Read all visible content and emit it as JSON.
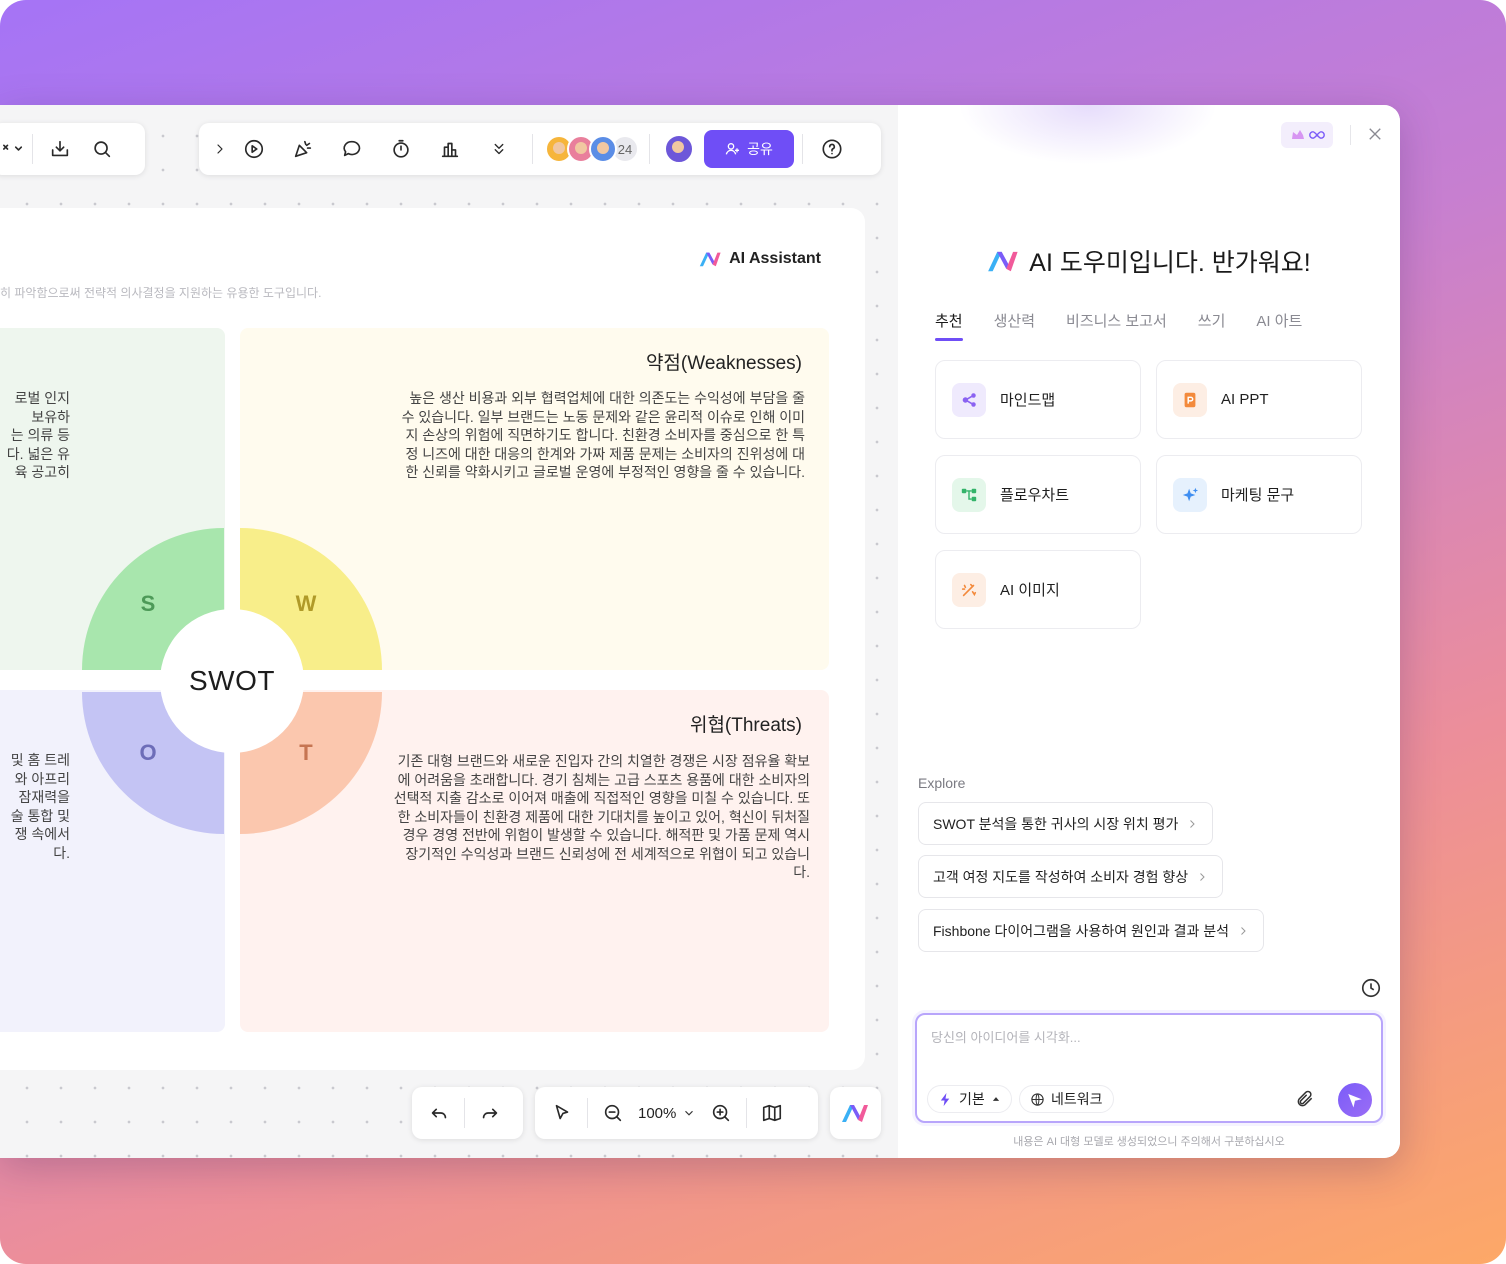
{
  "toolbar_top": {
    "left_items": [
      "export-icon",
      "search-icon"
    ],
    "collaborator_count": "24",
    "share_label": "공유"
  },
  "board": {
    "brand_label": "AI Assistant",
    "subtitle": "히 파악함으로써 전략적 의사결정을 지원하는 유용한 도구입니다.",
    "center_label": "SWOT",
    "letters": {
      "s": "S",
      "w": "W",
      "o": "O",
      "t": "T"
    },
    "strengths_lines": [
      "로벌 인지",
      "보유하",
      "는 의류 등",
      "다. 넓은 유",
      "육 공고히"
    ],
    "weaknesses": {
      "title": "약점(Weaknesses)",
      "body": "높은 생산 비용과 외부 협력업체에 대한 의존도는 수익성에 부담을 줄 수 있습니다. 일부 브랜드는 노동 문제와 같은 윤리적 이슈로 인해 이미지 손상의 위험에 직면하기도 합니다. 친환경 소비자를 중심으로 한 특정 니즈에 대한 대응의 한계와 가짜 제품 문제는 소비자의 진위성에 대한 신뢰를 약화시키고 글로벌 운영에 부정적인 영향을 줄 수 있습니다."
    },
    "opportunities_lines": [
      "및 홈 트레",
      "와 아프리",
      "잠재력을",
      "술 통합 및",
      "쟁 속에서",
      "다."
    ],
    "threats": {
      "title": "위협(Threats)",
      "body": "기존 대형 브랜드와 새로운 진입자 간의 치열한 경쟁은 시장 점유율 확보에 어려움을 초래합니다. 경기 침체는 고급 스포츠 용품에 대한 소비자의 선택적 지출 감소로 이어져 매출에 직접적인 영향을 미칠 수 있습니다. 또한 소비자들이 친환경 제품에 대한 기대치를 높이고 있어, 혁신이 뒤처질 경우 경영 전반에 위험이 발생할 수 있습니다. 해적판 및 가품 문제 역시 장기적인 수익성과 브랜드 신뢰성에 전 세계적으로 위협이 되고 있습니다."
    }
  },
  "toolbar_bottom": {
    "zoom": "100%"
  },
  "panel": {
    "greeting": "AI 도우미입니다. 반가워요!",
    "tabs": [
      "추천",
      "생산력",
      "비즈니스 보고서",
      "쓰기",
      "AI 아트"
    ],
    "cards": [
      {
        "label": "마인드맵",
        "icon": "mindmap-icon",
        "bg": "#efeafd",
        "fg": "#8a62f2"
      },
      {
        "label": "AI PPT",
        "icon": "ppt-icon",
        "bg": "#fdeee4",
        "fg": "#f38a3c"
      },
      {
        "label": "플로우차트",
        "icon": "flowchart-icon",
        "bg": "#e4f7ea",
        "fg": "#34b46a"
      },
      {
        "label": "마케팅 문구",
        "icon": "sparkle-icon",
        "bg": "#e6f1fd",
        "fg": "#3f8ef1"
      },
      {
        "label": "AI 이미지",
        "icon": "ai-image-icon",
        "bg": "#fdeee4",
        "fg": "#f38a3c"
      }
    ],
    "explore_label": "Explore",
    "explore_items": [
      "SWOT 분석을 통한 귀사의 시장 위치 평가",
      "고객 여정 지도를 작성하여 소비자 경험 향상",
      "Fishbone 다이어그램을 사용하여 원인과 결과 분석"
    ],
    "input_placeholder": "당신의 아이디어를 시각화...",
    "mode_label": "기본",
    "network_label": "네트워크",
    "disclaimer": "내용은 AI 대형 모델로 생성되었으니 주의해서 구분하십시오"
  }
}
